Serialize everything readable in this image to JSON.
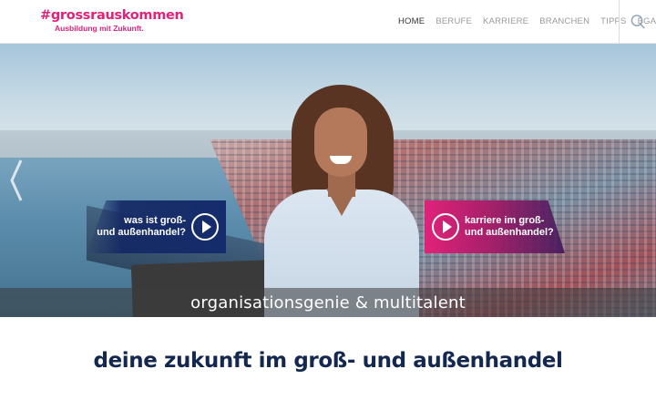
{
  "logo": {
    "main": "#grossrauskommen",
    "sub": "Ausbildung mit Zukunft."
  },
  "nav": {
    "items": [
      {
        "label": "HOME",
        "active": true
      },
      {
        "label": "BERUFE",
        "active": false
      },
      {
        "label": "KARRIERE",
        "active": false
      },
      {
        "label": "BRANCHEN",
        "active": false
      },
      {
        "label": "TIPPS",
        "active": false
      },
      {
        "label": "BGA",
        "active": false
      }
    ],
    "search_icon": "search-icon"
  },
  "hero": {
    "cta_left": "was ist groß-\nund außenhandel?",
    "cta_right": "karriere im groß-\nund außenhandel?",
    "caption": "organisationsgenie & multitalent",
    "prev_icon": "chevron-left-icon"
  },
  "headline": "deine zukunft im groß- und außenhandel",
  "colors": {
    "brand": "#e0227a",
    "navy": "#14284f"
  }
}
